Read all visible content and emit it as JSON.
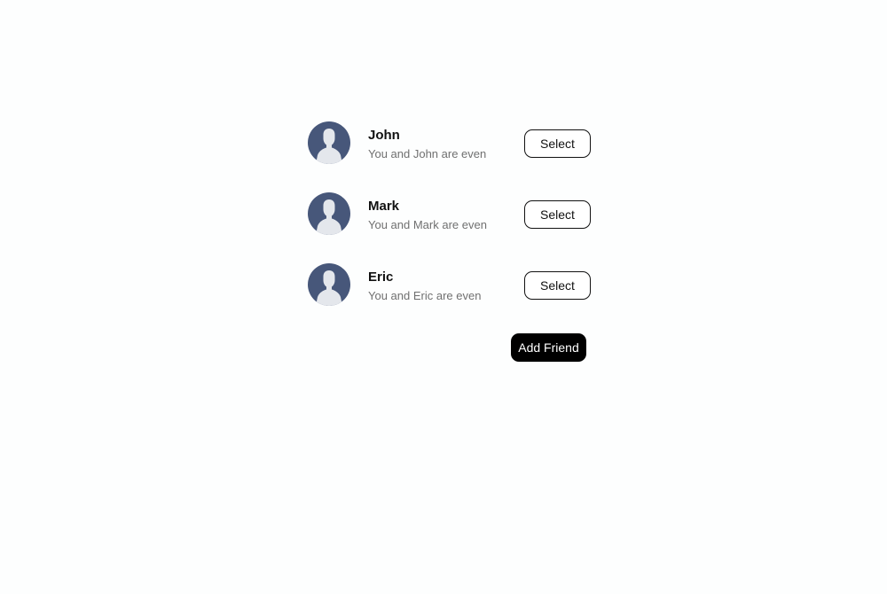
{
  "friends": [
    {
      "name": "John",
      "status": "You and John are even",
      "select_label": "Select"
    },
    {
      "name": "Mark",
      "status": "You and Mark are even",
      "select_label": "Select"
    },
    {
      "name": "Eric",
      "status": "You and Eric are even",
      "select_label": "Select"
    }
  ],
  "add_friend_label": "Add Friend",
  "colors": {
    "avatar_background": "#47577a",
    "avatar_silhouette": "#e4e7ec",
    "primary_button": "#000000",
    "secondary_text": "#707070"
  },
  "icons": {
    "avatar": "user-silhouette-icon"
  }
}
